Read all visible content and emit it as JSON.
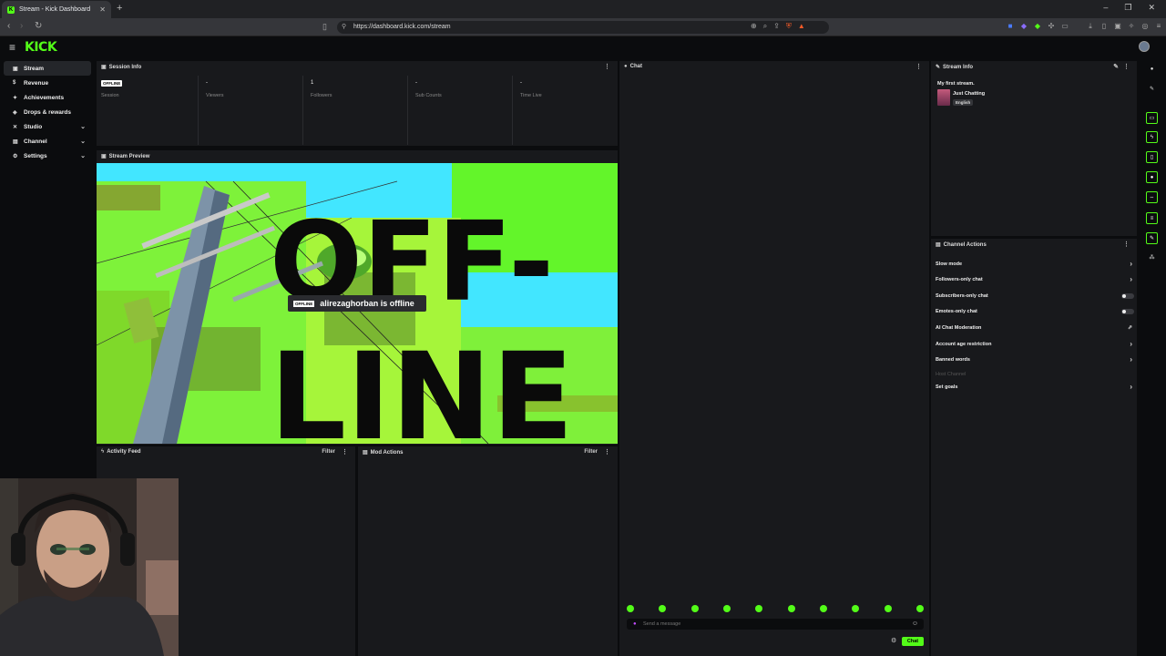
{
  "browser": {
    "tab_title": "Stream - Kick Dashboard",
    "tab_favicon_letter": "K",
    "new_tab": "+",
    "url": "https://dashboard.kick.com/stream",
    "window_controls": [
      "–",
      "❐",
      "✕"
    ]
  },
  "app": {
    "logo": "KICK",
    "accent": "#53fc18"
  },
  "sidebar": {
    "items": [
      {
        "label": "Stream",
        "icon": "video-icon",
        "active": true
      },
      {
        "label": "Revenue",
        "icon": "dollar-icon"
      },
      {
        "label": "Achievements",
        "icon": "trophy-icon"
      },
      {
        "label": "Drops & rewards",
        "icon": "gift-icon"
      },
      {
        "label": "Studio",
        "icon": "studio-icon",
        "chevron": true
      },
      {
        "label": "Channel",
        "icon": "channel-icon",
        "chevron": true
      },
      {
        "label": "Settings",
        "icon": "gear-icon",
        "chevron": true
      }
    ]
  },
  "session_info": {
    "title": "Session Info",
    "stats": [
      {
        "value": "OFFLINE",
        "label": "Session",
        "badge": true
      },
      {
        "value": "-",
        "label": "Viewers"
      },
      {
        "value": "1",
        "label": "Followers"
      },
      {
        "value": "-",
        "label": "Sub Counts"
      },
      {
        "value": "-",
        "label": "Time Live"
      }
    ]
  },
  "stream_preview": {
    "title": "Stream Preview",
    "offline_badge": "OFFLINE",
    "offline_text": "alirezaghorban is offline",
    "art_text_1": "OFF-",
    "art_text_2": "LINE"
  },
  "activity_feed": {
    "title": "Activity Feed",
    "filter": "Filter"
  },
  "mod_actions": {
    "title": "Mod Actions",
    "filter": "Filter"
  },
  "chat": {
    "title": "Chat",
    "placeholder": "Send a message",
    "send_label": "Chat",
    "emote_count": 10
  },
  "stream_info": {
    "title": "Stream Info",
    "stream_title": "My first stream.",
    "category": "Just Chatting",
    "language": "English"
  },
  "channel_actions": {
    "title": "Channel Actions",
    "items": [
      {
        "label": "Slow mode",
        "control": "chevron"
      },
      {
        "label": "Followers-only chat",
        "control": "chevron"
      },
      {
        "label": "Subscribers-only chat",
        "control": "toggle"
      },
      {
        "label": "Emotes-only chat",
        "control": "toggle"
      },
      {
        "label": "AI Chat Moderation",
        "control": "external"
      },
      {
        "label": "Account age restriction",
        "control": "chevron"
      },
      {
        "label": "Banned words",
        "control": "chevron"
      },
      {
        "label": "Host Channel",
        "control": "none",
        "disabled": true
      },
      {
        "label": "Set goals",
        "control": "chevron"
      }
    ]
  }
}
